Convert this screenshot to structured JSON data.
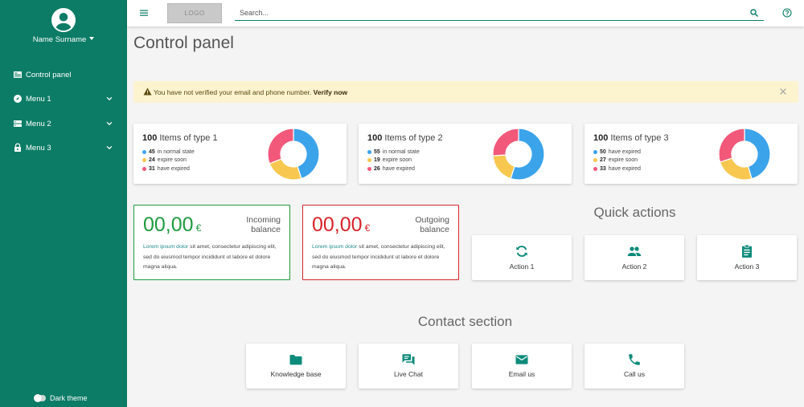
{
  "sidebar": {
    "user_name": "Name Surname",
    "items": [
      {
        "label": "Control panel",
        "icon": "dashboard-icon"
      },
      {
        "label": "Menu 1",
        "icon": "compass-icon"
      },
      {
        "label": "Menu 2",
        "icon": "storage-icon"
      },
      {
        "label": "Menu 3",
        "icon": "lock-icon"
      }
    ],
    "dark_theme_label": "Dark theme"
  },
  "topbar": {
    "logo_text": "LOGO",
    "search_placeholder": "Search..."
  },
  "page": {
    "title": "Control panel"
  },
  "alert": {
    "message": "You have not verified your email and phone number.",
    "action": "Verify now"
  },
  "colors": {
    "brand": "#0c7c66",
    "blue": "#3ba3ea",
    "yellow": "#f7c74f",
    "red": "#f2587a",
    "positive": "#1f9a3e",
    "negative": "#d8232a"
  },
  "stats": [
    {
      "count": "100",
      "title": "Items of type 1",
      "rows": [
        {
          "value": "45",
          "label": "in normal state"
        },
        {
          "value": "24",
          "label": "expire soon"
        },
        {
          "value": "31",
          "label": "have expired"
        }
      ],
      "values": [
        45,
        24,
        31
      ]
    },
    {
      "count": "100",
      "title": "Items of type 2",
      "rows": [
        {
          "value": "55",
          "label": "in normal state"
        },
        {
          "value": "19",
          "label": "expire soon"
        },
        {
          "value": "26",
          "label": "have expired"
        }
      ],
      "values": [
        55,
        19,
        26
      ]
    },
    {
      "count": "100",
      "title": "Items of type 3",
      "rows": [
        {
          "value": "50",
          "label": "have expired"
        },
        {
          "value": "27",
          "label": "expire soon"
        },
        {
          "value": "33",
          "label": "have expired"
        }
      ],
      "values": [
        50,
        27,
        33
      ]
    }
  ],
  "balances": {
    "incoming": {
      "amount": "00,00",
      "currency": "€",
      "label": "Incoming balance",
      "link": "Lorem ipsum dolor",
      "text": " sit amet, consectetur adipiscing elit, sed do eiusmod tempor incididunt ut labore et dolore magna aliqua."
    },
    "outgoing": {
      "amount": "00,00",
      "currency": "€",
      "label": "Outgoing balance",
      "link": "Lorem ipsum dolor",
      "text": " sit amet, consectetur adipiscing elit, sed do eiusmod tempor incididunt ut labore et dolore magna aliqua."
    }
  },
  "quick_actions": {
    "title": "Quick actions",
    "items": [
      {
        "label": "Action 1",
        "icon": "refresh-icon"
      },
      {
        "label": "Action 2",
        "icon": "people-icon"
      },
      {
        "label": "Action 3",
        "icon": "clipboard-icon"
      }
    ]
  },
  "contact": {
    "title": "Contact section",
    "items": [
      {
        "label": "Knowledge base",
        "icon": "folder-icon"
      },
      {
        "label": "Live Chat",
        "icon": "chat-icon"
      },
      {
        "label": "Email us",
        "icon": "mail-icon"
      },
      {
        "label": "Call us",
        "icon": "phone-icon"
      }
    ]
  }
}
